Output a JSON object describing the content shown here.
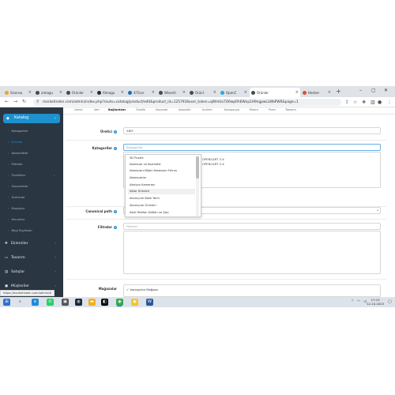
{
  "browser": {
    "tabs": [
      {
        "label": "Sisenso"
      },
      {
        "label": "almagu"
      },
      {
        "label": "Ürünler"
      },
      {
        "label": "Almagu"
      },
      {
        "label": "X-Ticar"
      },
      {
        "label": "Wisenti"
      },
      {
        "label": "Ürünl"
      },
      {
        "label": "OpenC"
      },
      {
        "label": "Ürünler"
      },
      {
        "label": "Hesher"
      }
    ],
    "new_tab": "+",
    "url": "marketinden.com/admin/index.php?route=catalog/product/edit&product_id=1257918user_token=qWmUo7O6wpRh6Wxp1H9ngpwLLWbPW6&page=1"
  },
  "sidebar": {
    "catalog_label": "Katalog",
    "catalog_items": [
      "Kategoriler",
      "Ürünler",
      "Abonelikler",
      "Filtreler",
      "Özellikler",
      "Seçenekler",
      "Üreticiler",
      "Dosyalar",
      "Yorumlar",
      "Bilgi Sayfaları"
    ],
    "main_items": [
      {
        "label": "Eklentiler"
      },
      {
        "label": "Tasarım"
      },
      {
        "label": "Satışlar"
      },
      {
        "label": "Müşteriler"
      }
    ]
  },
  "page_tabs": [
    "Genel",
    "Veri",
    "Bağlantılar",
    "Özellik",
    "Seçenek",
    "Abonelik",
    "İndirim",
    "Kampanya",
    "Resim",
    "Puan",
    "Tasarım"
  ],
  "form": {
    "manufacturer_label": "Üretici",
    "manufacturer_value": "ABM",
    "categories_label": "Kategoriler",
    "categories_placeholder": "Kategoriler",
    "selected_categories": [
      "OPENCART 3.X",
      "OPENCART 2.X"
    ],
    "canonical_label": "Canonical path",
    "filters_label": "Filtreler",
    "filters_placeholder": "Filtreler",
    "stores_label": "Mağazalar",
    "store_default": "Varsayılan Mağaza"
  },
  "category_dropdown": [
    "3D Puzzle",
    "Aksesuar ve Kozmetik",
    "Aksesuar>Diğer Aksesuarı Ferrus",
    "Aksesuarlar",
    "Aksiyon Kamerası",
    "Aktar Ürünleri",
    "Akvaryum Balık Yemi",
    "Akvaryum Ürünleri",
    "Akıllı Telefon Kılıfları ve Şarj"
  ],
  "status_url": "https://marketinden.com/admin/#",
  "taskbar": {
    "time": "17:13",
    "date": "12.10.2023"
  }
}
